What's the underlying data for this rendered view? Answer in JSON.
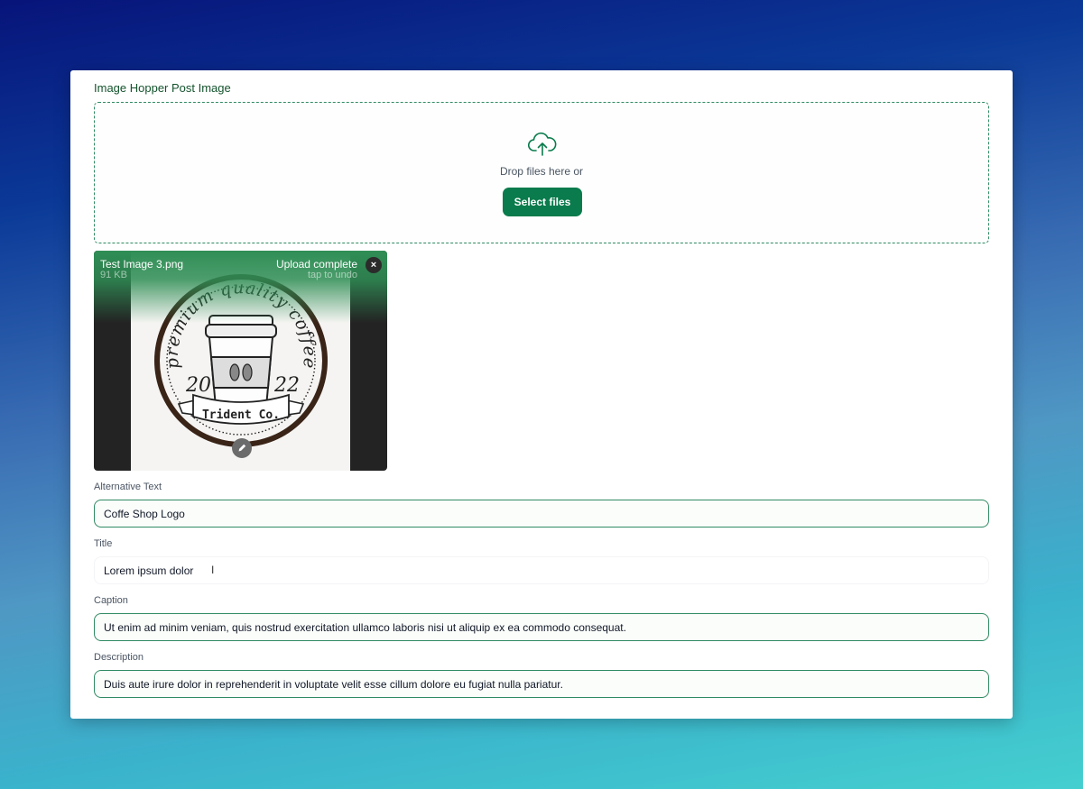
{
  "field": {
    "title": "Image Hopper Post Image"
  },
  "dropzone": {
    "icon": "cloud-upload-icon",
    "text": "Drop files here or",
    "button_label": "Select files"
  },
  "file": {
    "name": "Test Image 3.png",
    "size": "91 KB",
    "status": "Upload complete",
    "undo": "tap to undo",
    "close_label": "×"
  },
  "logo": {
    "arc_text": "premium quality coffee",
    "year_left": "20",
    "year_right": "22",
    "banner": "Trident Co."
  },
  "fields": {
    "alt": {
      "label": "Alternative Text",
      "value": "Coffe Shop Logo"
    },
    "title": {
      "label": "Title",
      "value": "Lorem ipsum dolor"
    },
    "caption": {
      "label": "Caption",
      "value": "Ut enim ad minim veniam, quis nostrud exercitation ullamco laboris nisi ut aliquip ex ea commodo consequat."
    },
    "description": {
      "label": "Description",
      "value": "Duis aute irure dolor in reprehenderit in voluptate velit esse cillum dolore eu fugiat nulla pariatur."
    }
  },
  "colors": {
    "accent": "#0a7b4c",
    "border": "#2f8a63"
  }
}
